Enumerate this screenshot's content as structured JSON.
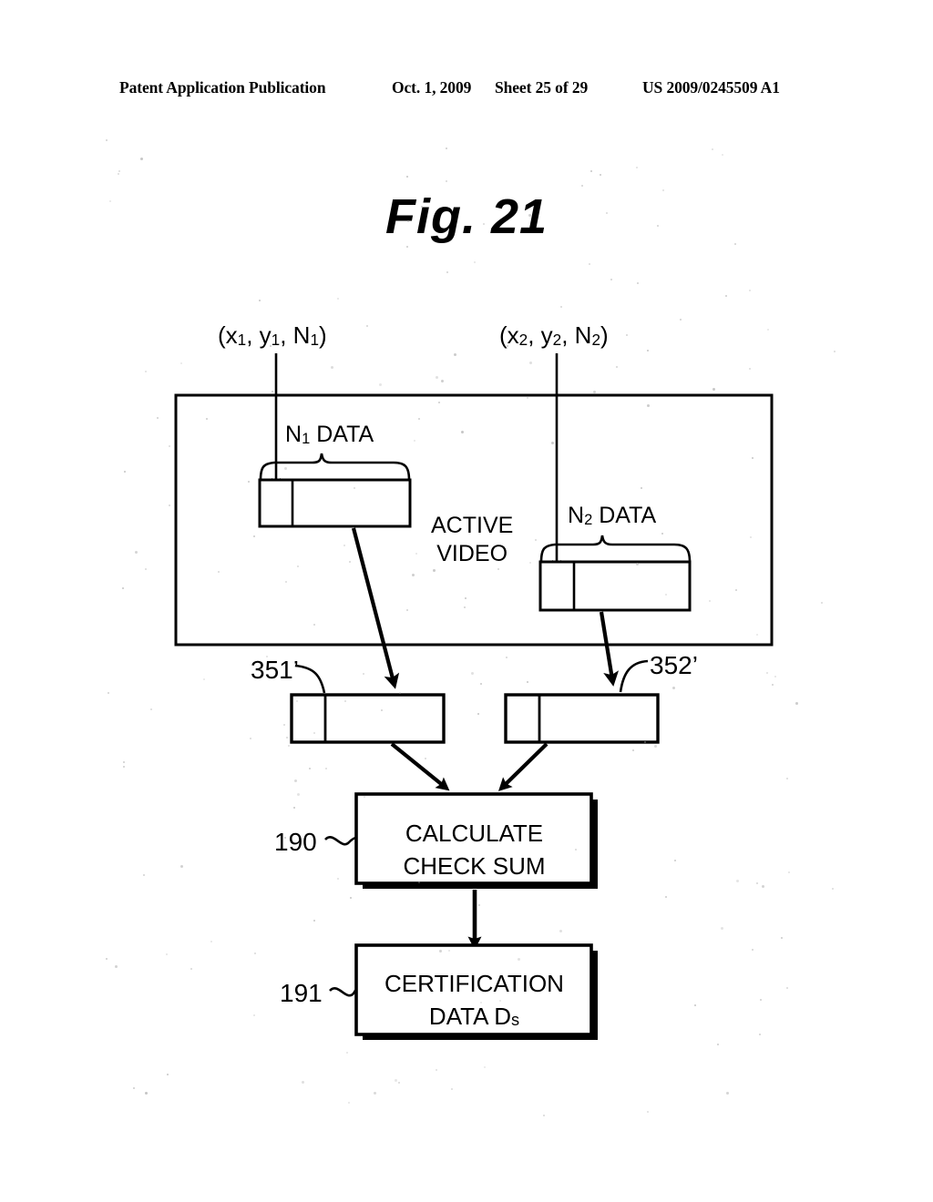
{
  "header": {
    "publication": "Patent Application Publication",
    "date": "Oct. 1, 2009",
    "sheet": "Sheet 25 of 29",
    "patent_number": "US 2009/0245509 A1"
  },
  "figure": {
    "title": "Fig. 21"
  },
  "diagram": {
    "coord_label_1": "(x₁, y₁, N₁)",
    "coord_label_2": "(x₂, y₂, N₂)",
    "n1_data_label": "N₁ DATA",
    "n2_data_label": "N₂ DATA",
    "active_video_line1": "ACTIVE",
    "active_video_line2": "VIDEO",
    "ref_351": "351’",
    "ref_352": "352’",
    "ref_190": "190",
    "ref_191": "191",
    "calculate_box_line1": "CALCULATE",
    "calculate_box_line2": "CHECK SUM",
    "certification_box_line1": "CERTIFICATION",
    "certification_box_line2_main": "DATA D",
    "certification_box_line2_sub": "s",
    "ink_color": "#000000",
    "page_color": "#ffffff"
  }
}
